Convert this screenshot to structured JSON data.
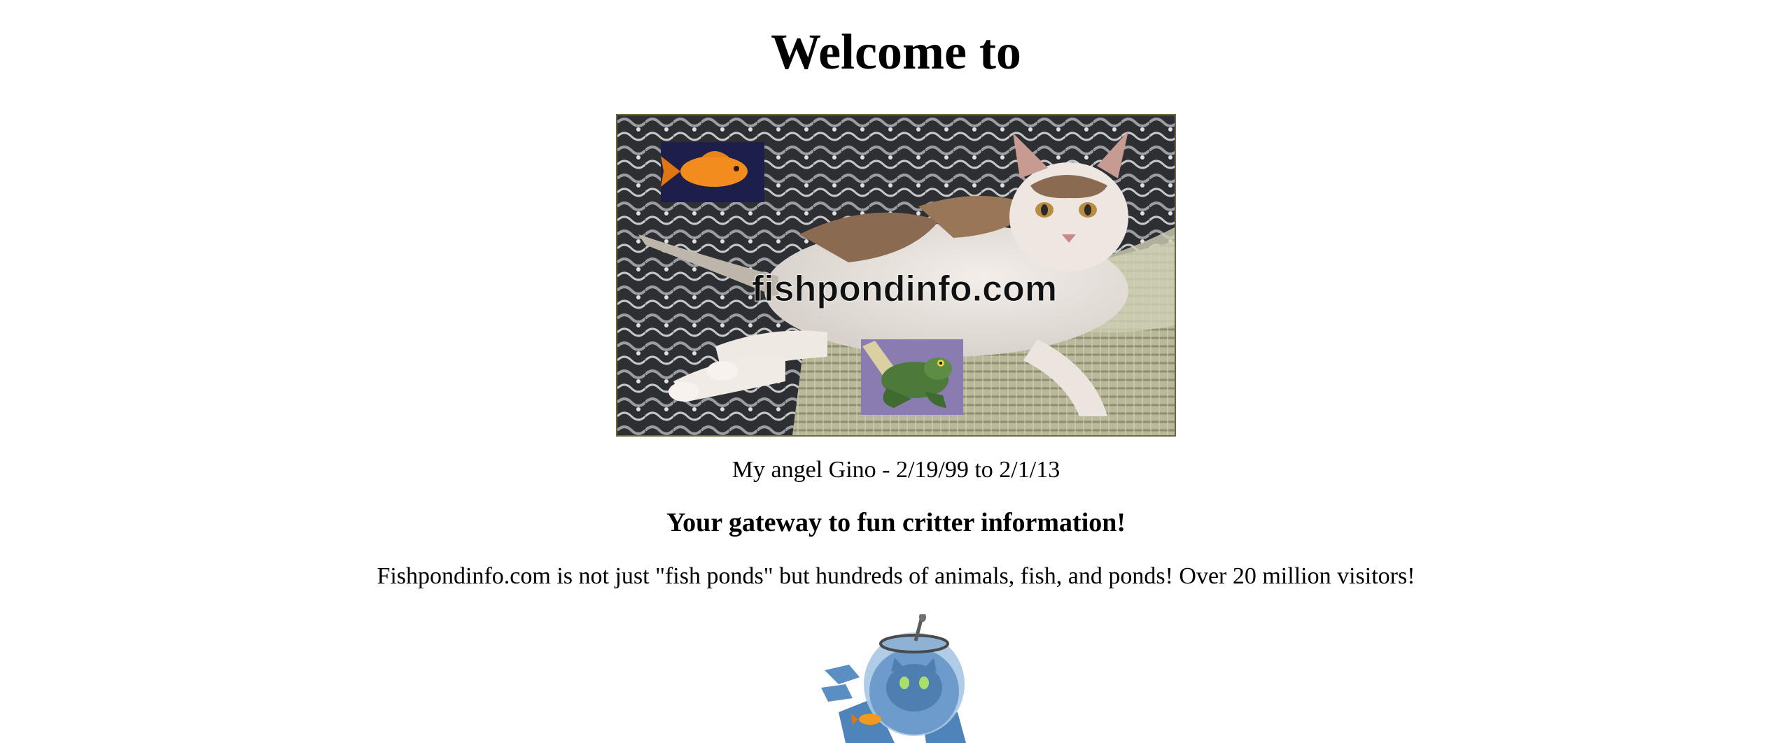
{
  "header": {
    "title": "Welcome to"
  },
  "banner": {
    "logo_text": "fishpondinfo.com"
  },
  "caption": "My angel Gino - 2/19/99 to 2/1/13",
  "tagline": "Your gateway to fun critter information!",
  "intro": "Fishpondinfo.com is not just \"fish ponds\" but hundreds of animals, fish, and ponds! Over 20 million visitors!",
  "colors": {
    "background": "#ffffff",
    "text": "#000000",
    "banner_border": "#6b6a3c",
    "goldfish": "#f28c1e",
    "frog": "#4d7a3a",
    "bowl_blue": "#5b8fc4"
  },
  "icons": [
    "goldfish-icon",
    "frog-icon",
    "fishbowl-cat-icon"
  ]
}
